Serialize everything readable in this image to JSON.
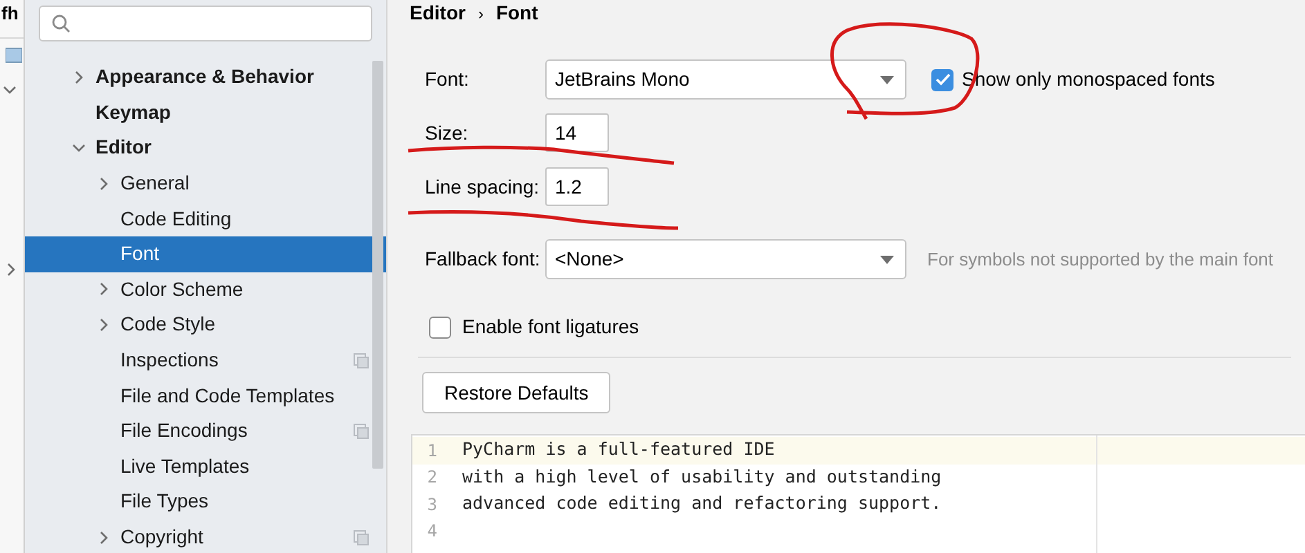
{
  "background_window": {
    "title": "fh"
  },
  "sidebar": {
    "items": [
      {
        "label": "Appearance & Behavior",
        "kind": "group",
        "expanded": false,
        "scoped": false,
        "selected": false
      },
      {
        "label": "Keymap",
        "kind": "page",
        "scoped": false,
        "selected": false
      },
      {
        "label": "Editor",
        "kind": "group",
        "expanded": true,
        "scoped": false,
        "selected": false,
        "children": [
          {
            "label": "General",
            "kind": "group",
            "expanded": false,
            "scoped": false,
            "selected": false
          },
          {
            "label": "Code Editing",
            "kind": "page",
            "scoped": false,
            "selected": false
          },
          {
            "label": "Font",
            "kind": "page",
            "scoped": false,
            "selected": true
          },
          {
            "label": "Color Scheme",
            "kind": "group",
            "expanded": false,
            "scoped": false,
            "selected": false
          },
          {
            "label": "Code Style",
            "kind": "group",
            "expanded": false,
            "scoped": false,
            "selected": false
          },
          {
            "label": "Inspections",
            "kind": "page",
            "scoped": true,
            "selected": false
          },
          {
            "label": "File and Code Templates",
            "kind": "page",
            "scoped": false,
            "selected": false
          },
          {
            "label": "File Encodings",
            "kind": "page",
            "scoped": true,
            "selected": false
          },
          {
            "label": "Live Templates",
            "kind": "page",
            "scoped": false,
            "selected": false
          },
          {
            "label": "File Types",
            "kind": "page",
            "scoped": false,
            "selected": false
          },
          {
            "label": "Copyright",
            "kind": "group",
            "expanded": false,
            "scoped": true,
            "selected": false
          }
        ]
      }
    ]
  },
  "breadcrumb": [
    "Editor",
    "›",
    "Font"
  ],
  "font": {
    "label": "Font:",
    "value": "JetBrains Mono",
    "monospaced_only": {
      "label": "Show only monospaced fonts",
      "checked": true
    }
  },
  "size": {
    "label": "Size:",
    "value": "14"
  },
  "line_spacing": {
    "label": "Line spacing:",
    "value": "1.2"
  },
  "fallback_font": {
    "label": "Fallback font:",
    "value": "<None>",
    "hint": "For symbols not supported by the main font"
  },
  "ligatures": {
    "label": "Enable font ligatures",
    "checked": false
  },
  "restore_button": "Restore Defaults",
  "preview": {
    "lines": [
      {
        "number": "1",
        "text": "PyCharm is a full-featured IDE",
        "current": true
      },
      {
        "number": "2",
        "text": "with a high level of usability and outstanding",
        "current": false
      },
      {
        "number": "3",
        "text": "advanced code editing and refactoring support.",
        "current": false
      },
      {
        "number": "4",
        "current": false
      }
    ]
  }
}
